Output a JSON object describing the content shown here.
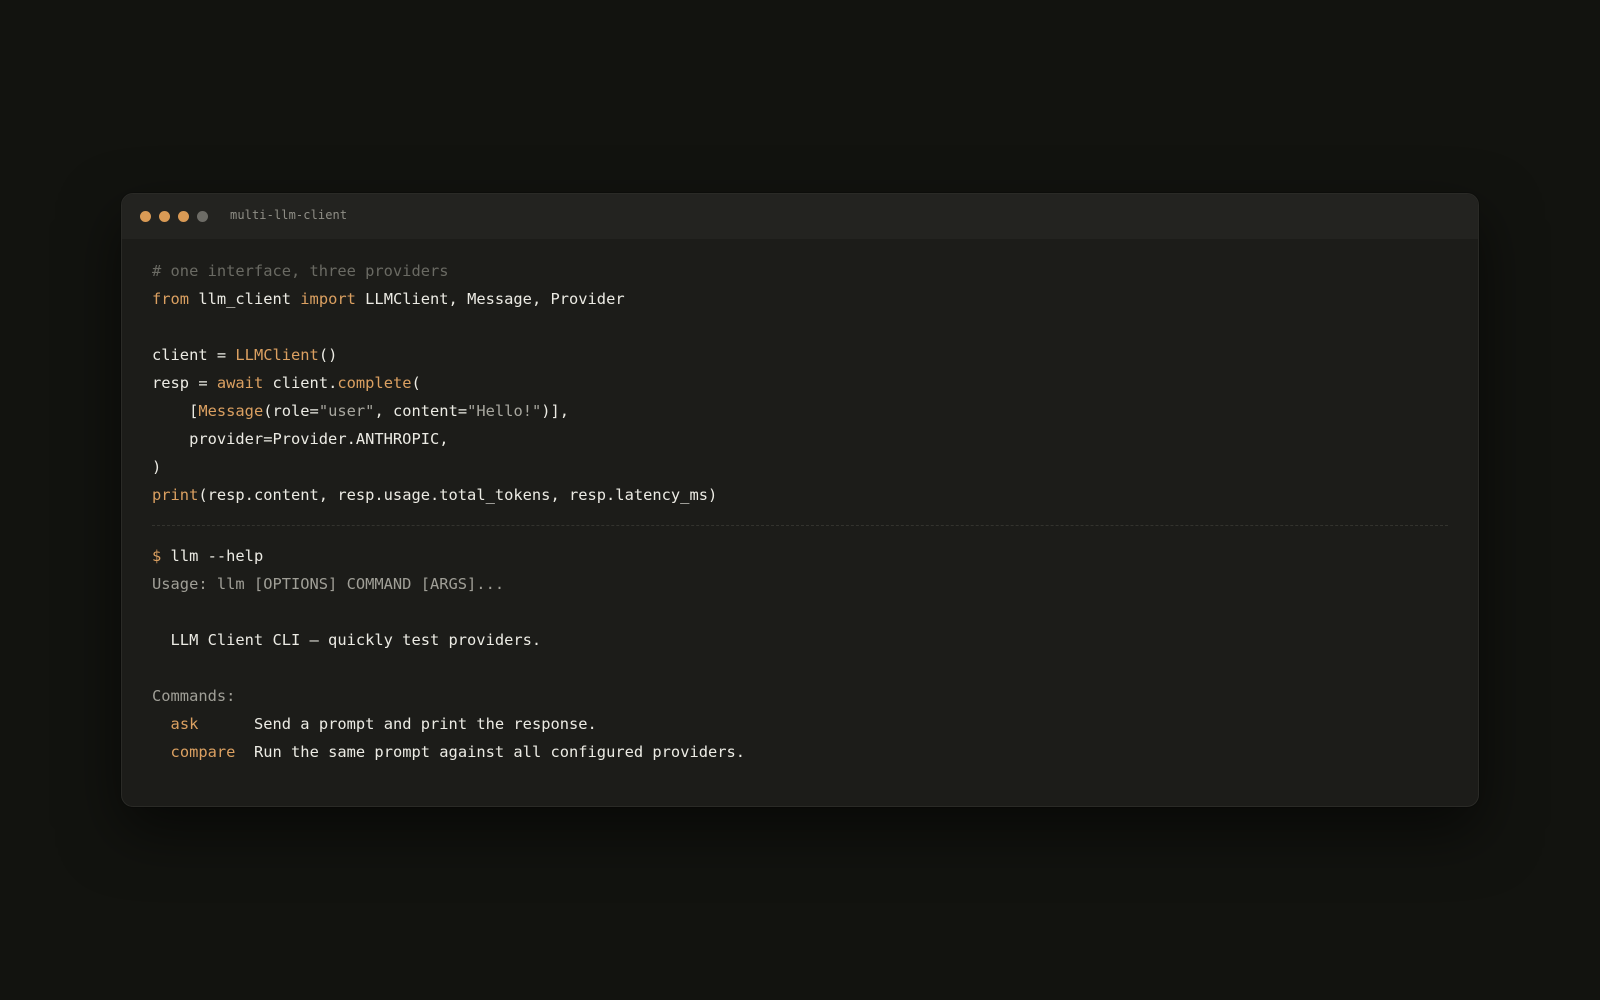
{
  "window": {
    "title": "multi-llm-client",
    "dots": [
      {
        "name": "dot-1",
        "color": "#d99a55"
      },
      {
        "name": "dot-2",
        "color": "#d99a55"
      },
      {
        "name": "dot-3",
        "color": "#d99a55"
      },
      {
        "name": "dot-4",
        "color": "#6d6c66"
      }
    ]
  },
  "colors": {
    "background": "#12130f",
    "panel": "#1c1c19",
    "titlebar": "#232320",
    "accent": "#dba061",
    "text": "#ecebe4",
    "muted": "#a09f97",
    "comment": "#6a6a63"
  },
  "code": {
    "comment": "# one interface, three providers",
    "from_kw": "from",
    "module": " llm_client ",
    "import_kw": "import",
    "imports": " LLMClient, Message, Provider",
    "client_assign": "client = ",
    "client_ctor": "LLMClient",
    "client_parens": "()",
    "resp_assign": "resp = ",
    "await_kw": "await",
    "client_obj": " client.",
    "complete_fn": "complete",
    "open_paren": "(",
    "msg_indent": "    [",
    "msg_fn": "Message",
    "msg_role_key": "(role=",
    "msg_role_val": "\"user\"",
    "msg_content_key": ", content=",
    "msg_content_val": "\"Hello!\"",
    "msg_close": ")],",
    "provider_line": "    provider=Provider.ANTHROPIC,",
    "close_paren": ")",
    "print_fn": "print",
    "print_args": "(resp.content, resp.usage.total_tokens, resp.latency_ms)"
  },
  "terminal": {
    "prompt": "$",
    "command": " llm --help",
    "usage": "Usage: llm [OPTIONS] COMMAND [ARGS]...",
    "description": "  LLM Client CLI — quickly test providers.",
    "commands_header": "Commands:",
    "commands": [
      {
        "name": "ask",
        "pad": "      ",
        "description": "Send a prompt and print the response."
      },
      {
        "name": "compare",
        "pad": "  ",
        "description": "Run the same prompt against all configured providers."
      }
    ]
  }
}
